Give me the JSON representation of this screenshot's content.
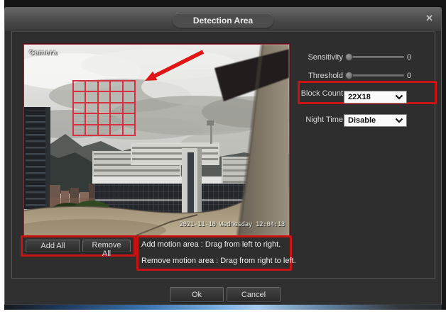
{
  "window": {
    "title": "Detection Area",
    "close_icon": "✕"
  },
  "preview": {
    "camera_label": "Camera",
    "timestamp": "2021-11-10 Wednesday 12:04:13",
    "grid_rows": 5,
    "grid_cols": 5
  },
  "controls": {
    "sensitivity_label": "Sensitivity",
    "sensitivity_value": "0",
    "threshold_label": "Threshold",
    "threshold_value": "0",
    "block_count_label": "Block Count",
    "block_count_value": "22X18",
    "night_time_label": "Night Time",
    "night_time_value": "Disable"
  },
  "buttons": {
    "add_all": "Add All",
    "remove_all": "Remove All",
    "ok": "Ok",
    "cancel": "Cancel"
  },
  "help": {
    "add_line": "Add motion area : Drag from left to right.",
    "remove_line": "Remove motion area : Drag from right to left."
  },
  "colors": {
    "annotation_red": "#c81414",
    "grid_red": "#d8303e",
    "accent_blue": "#4d86c4"
  }
}
